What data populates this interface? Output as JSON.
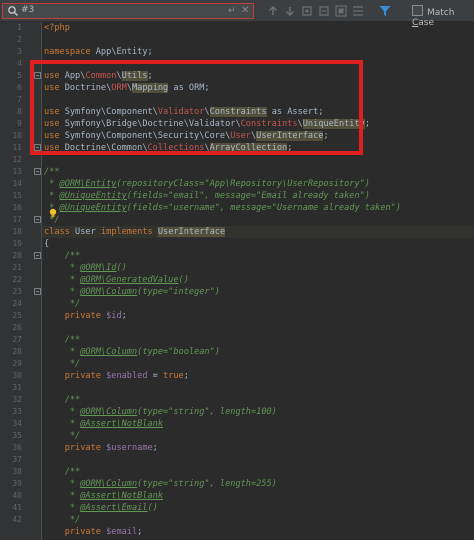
{
  "search": {
    "value": "#3",
    "return_glyph": "↵",
    "clear_glyph": "✕",
    "match_case_prefix": "Match ",
    "match_case_underlined": "C",
    "match_case_suffix": "ase"
  },
  "colors": {
    "background": "#2b2b2b",
    "gutter": "#313335",
    "keyword": "#cc7832",
    "comment": "#629755",
    "annotation_box": "#e02020"
  },
  "line_numbers": [
    "1",
    "2",
    "3",
    "4",
    "5",
    "6",
    "7",
    "8",
    "9",
    "10",
    "11",
    "12",
    "13",
    "14",
    "15",
    "16",
    "17",
    "18",
    "19",
    "20",
    "21",
    "22",
    "23",
    "24",
    "25",
    "26",
    "27",
    "28",
    "29",
    "30",
    "31",
    "32",
    "33",
    "34",
    "35",
    "36",
    "37",
    "38",
    "39",
    "40",
    "41",
    "42"
  ],
  "code": {
    "l1": "<?php",
    "l3_kw": "namespace",
    "l3_ns": " App\\Entity;",
    "l5_kw": "use",
    "l5_a": " App\\",
    "l5_b": "Common",
    "l5_c": "\\",
    "l5_d": "Utils",
    "l5_e": ";",
    "l6_kw": "use",
    "l6_a": " Doctrine\\",
    "l6_b": "ORM",
    "l6_c": "\\",
    "l6_d": "Mapping",
    "l6_e": " as ORM;",
    "l8_kw": "use",
    "l8_a": " Symfony\\Component\\",
    "l8_b": "Validator",
    "l8_c": "\\",
    "l8_d": "Constraints",
    "l8_e": " as Assert;",
    "l9_kw": "use",
    "l9_a": " Symfony\\Bridge\\Doctrine\\Validator\\",
    "l9_b": "Constraints",
    "l9_c": "\\",
    "l9_d": "UniqueEntity",
    "l9_e": ";",
    "l10_kw": "use",
    "l10_a": " Symfony\\Component\\Security\\Core\\",
    "l10_b": "User",
    "l10_c": "\\",
    "l10_d": "UserInterface",
    "l10_e": ";",
    "l11_kw": "use",
    "l11_a": " Doctrine\\Common\\",
    "l11_b": "Collections",
    "l11_c": "\\",
    "l11_d": "ArrayCollection",
    "l11_e": ";",
    "l13": "/**",
    "l14_a": " * ",
    "l14_tag": "@ORM\\Entity",
    "l14_b": "(repositoryClass=\"App\\Repository\\UserRepository\")",
    "l15_a": " * ",
    "l15_tag": "@UniqueEntity",
    "l15_b": "(fields=\"email\", message=\"Email already taken\")",
    "l16_a": " * ",
    "l16_tag": "@UniqueEntity",
    "l16_b": "(fields=\"username\", message=\"Username already taken\")",
    "l17": " */",
    "l18_kw1": "class",
    "l18_a": " User ",
    "l18_kw2": "implements",
    "l18_b": " ",
    "l18_c": "UserInterface",
    "l19": "{",
    "l20": "    /**",
    "l21_a": "     * ",
    "l21_tag": "@ORM\\Id",
    "l21_b": "()",
    "l22_a": "     * ",
    "l22_tag": "@ORM\\GeneratedValue",
    "l22_b": "()",
    "l23_a": "     * ",
    "l23_tag": "@ORM\\Column",
    "l23_b": "(type=\"integer\")",
    "l24": "     */",
    "l25_kw": "    private",
    "l25_var": " $id",
    "l25_e": ";",
    "l27": "    /**",
    "l28_a": "     * ",
    "l28_tag": "@ORM\\Column",
    "l28_b": "(type=\"boolean\")",
    "l29": "     */",
    "l30_kw": "    private",
    "l30_var": " $enabled",
    "l30_b": " = ",
    "l30_kw2": "true",
    "l30_e": ";",
    "l32": "    /**",
    "l33_a": "     * ",
    "l33_tag": "@ORM\\Column",
    "l33_b": "(type=\"string\", length=100)",
    "l34_a": "     * ",
    "l34_tag": "@Assert\\NotBlank",
    "l34_b": "",
    "l35": "     */",
    "l36_kw": "    private",
    "l36_var": " $username",
    "l36_e": ";",
    "l38": "    /**",
    "l39_a": "     * ",
    "l39_tag": "@ORM\\Column",
    "l39_b": "(type=\"string\", length=255)",
    "l40_a": "     * ",
    "l40_tag": "@Assert\\NotBlank",
    "l40_b": "",
    "l41_a": "     * ",
    "l41_tag": "@Assert\\Email",
    "l41_b": "()",
    "l42": "     */",
    "l43_kw": "    private",
    "l43_var": " $email",
    "l43_e": ";"
  }
}
